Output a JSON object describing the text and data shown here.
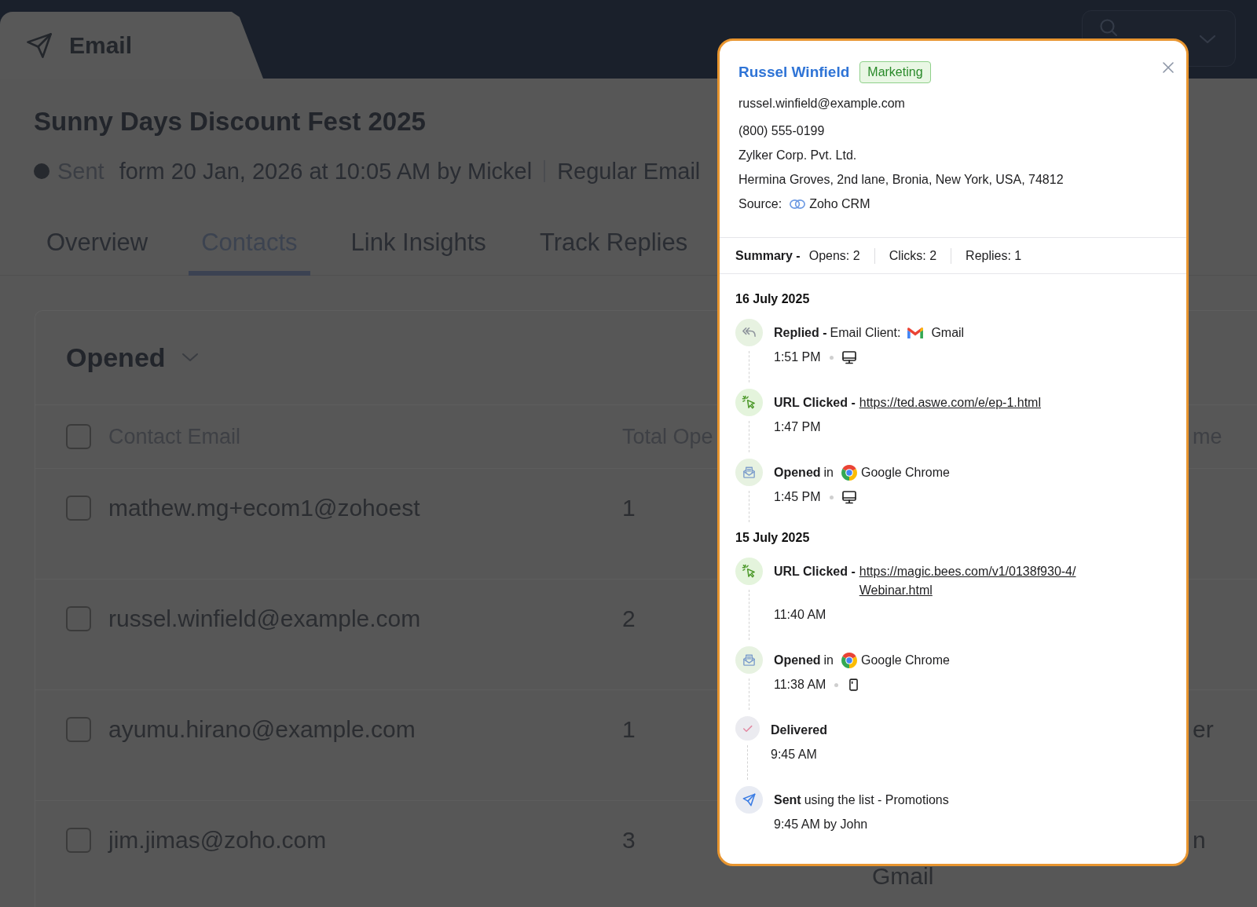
{
  "top_bar": {
    "tab": {
      "label": "Email"
    }
  },
  "campaign": {
    "title": "Sunny Days Discount Fest 2025",
    "status": "Sent",
    "sent_info": "form 20 Jan, 2026 at 10:05 AM by Mickel",
    "email_type": "Regular Email"
  },
  "tabs": [
    {
      "label": "Overview",
      "selected": false
    },
    {
      "label": "Contacts",
      "selected": true
    },
    {
      "label": "Link Insights",
      "selected": false
    },
    {
      "label": "Track Replies",
      "selected": false
    }
  ],
  "filter": {
    "label": "Opened"
  },
  "table": {
    "header_checked": false,
    "columns": {
      "contact_email": "Contact Email",
      "column_2": "Total Ope",
      "column_4": "me"
    },
    "rows": [
      {
        "checked": false,
        "contact_email": "mathew.mg+ecom1@zohoest",
        "column_2": "1"
      },
      {
        "checked": false,
        "contact_email": "russel.winfield@example.com",
        "column_2": "2"
      },
      {
        "checked": false,
        "contact_email": "ayumu.hirano@example.com",
        "column_2": "1",
        "column_4": "er"
      },
      {
        "checked": false,
        "contact_email": "jim.jimas@zoho.com",
        "column_2": "3",
        "column_3": "Gmail",
        "column_4": "n"
      }
    ]
  },
  "contact_popup": {
    "name": "Russel Winfield",
    "tag": "Marketing",
    "email": "russel.winfield@example.com",
    "phone": "(800) 555-0199",
    "company": "Zylker Corp. Pvt. Ltd.",
    "address": "Hermina Groves, 2nd lane, Bronia, New York, USA, 74812",
    "source_label": "Source:",
    "source": "Zoho CRM",
    "summary": {
      "label": "Summary -",
      "stats": [
        "Opens: 2",
        "Clicks: 2",
        "Replies: 1"
      ]
    },
    "timeline": [
      {
        "date": "16 July 2025",
        "events": [
          {
            "kind": "replied",
            "title": "Replied -",
            "text": "Email Client:",
            "app": {
              "kind": "mail",
              "name": "Gmail"
            },
            "time": "1:51 PM",
            "device": {
              "kind": "desktop"
            }
          },
          {
            "kind": "url_clicked",
            "title": "URL Clicked -",
            "link": "https://ted.aswe.com/e/ep-1.html",
            "time": "1:47 PM"
          },
          {
            "kind": "opened",
            "title": "Opened",
            "text": "in",
            "app": {
              "kind": "browser",
              "name": "Google Chrome"
            },
            "time": "1:45 PM",
            "device": {
              "kind": "desktop"
            }
          }
        ]
      },
      {
        "date": "15 July 2025",
        "events": [
          {
            "kind": "url_clicked",
            "title": "URL Clicked -",
            "link": "https://magic.bees.com/v1/0138f930-4/Webinar.html",
            "time": "11:40 AM"
          },
          {
            "kind": "opened",
            "title": "Opened",
            "text": "in",
            "app": {
              "kind": "browser",
              "name": "Google Chrome"
            },
            "time": "11:38 AM",
            "device": {
              "kind": "mobile"
            }
          },
          {
            "kind": "delivered",
            "title": "Delivered",
            "time": "9:45 AM"
          },
          {
            "kind": "sent",
            "title": "Sent",
            "text": "using the list - Promotions",
            "time": "9:45 AM by John"
          }
        ]
      }
    ]
  }
}
